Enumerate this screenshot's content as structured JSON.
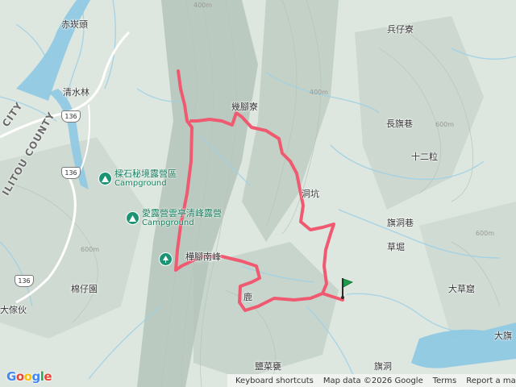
{
  "map": {
    "places": [
      {
        "name": "place-chibatou",
        "text": "赤崁頭"
      },
      {
        "name": "place-bingzailiao",
        "text": "兵仔寮"
      },
      {
        "name": "place-qingshuilin",
        "text": "清水林"
      },
      {
        "name": "place-jijiaoliao",
        "text": "幾腳寮"
      },
      {
        "name": "place-changqixiang",
        "text": "長旗巷"
      },
      {
        "name": "place-shierli",
        "text": "十二粒"
      },
      {
        "name": "place-dongkeng",
        "text": "洞坑"
      },
      {
        "name": "place-qidongxiang",
        "text": "旗洞巷"
      },
      {
        "name": "place-caoduan",
        "text": "草堀"
      },
      {
        "name": "place-mianzaiyuan",
        "text": "棉仔園"
      },
      {
        "name": "place-daxiangfu",
        "text": "大傢伙"
      },
      {
        "name": "place-dacaoku",
        "text": "大草窟"
      },
      {
        "name": "place-lu",
        "text": "鹿"
      },
      {
        "name": "place-yancaikeng",
        "text": "鹽菜甕"
      },
      {
        "name": "place-qidong",
        "text": "旗洞"
      },
      {
        "name": "place-daqi",
        "text": "大旗"
      },
      {
        "name": "place-lizhengmiao",
        "text": "樺腳南峰"
      }
    ],
    "counties": [
      {
        "name": "county-label-city",
        "text": "CITY"
      },
      {
        "name": "county-label-county",
        "text": "ILITOU COUNTY"
      }
    ],
    "pois": [
      {
        "name": "poi-campground-1",
        "label": "樑石秘境露營區",
        "sub": "Campground"
      },
      {
        "name": "poi-campground-2",
        "label": "愛露營雲亭清峰露營",
        "sub": "Campground"
      }
    ],
    "route_shields": [
      "136",
      "136",
      "136"
    ],
    "contours": [
      "400m",
      "600m",
      "600m",
      "600m",
      "400m"
    ],
    "colors": {
      "route": "#f05a70",
      "water": "#a8d4e6",
      "poi": "#1a9473",
      "marker": "#1e9d4a"
    }
  },
  "footer": {
    "shortcuts": "Keyboard shortcuts",
    "mapdata": "Map data ©2026 Google",
    "terms": "Terms",
    "report": "Report a map error"
  },
  "branding": {
    "logo": "Google"
  }
}
